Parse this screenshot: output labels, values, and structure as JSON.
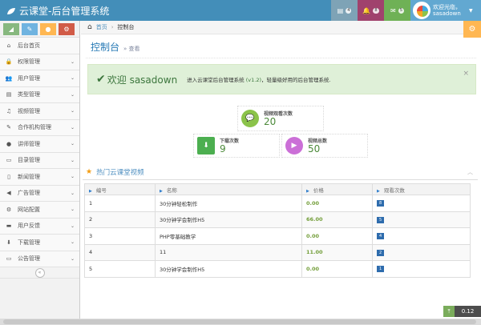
{
  "app": {
    "title": "云课堂-后台管理系统",
    "user_greeting": "欢迎光临，",
    "username": "sasadown"
  },
  "topbar": {
    "tasks_count": "4",
    "notifications_count": "8",
    "messages_count": "5"
  },
  "colors": {
    "navbar": "#438eb9",
    "user": "#62a8d1",
    "tb_tasks": "#7ea3b6",
    "tb_notify": "#a0426d",
    "tb_messages": "#6fb156",
    "settings": "#ffb752"
  },
  "shortcuts": [
    {
      "icon": "signal-icon",
      "color": "#87b87f"
    },
    {
      "icon": "pencil-icon",
      "color": "#6fb3e0"
    },
    {
      "icon": "group-icon",
      "color": "#ffb752"
    },
    {
      "icon": "cogs-icon",
      "color": "#d15b47"
    }
  ],
  "sidebar": {
    "items": [
      {
        "label": "后台首页",
        "icon": "home-icon",
        "glyph": "⌂",
        "arrow": false
      },
      {
        "label": "权限管理",
        "icon": "lock-icon",
        "glyph": "🔒",
        "arrow": true
      },
      {
        "label": "用户管理",
        "icon": "users-icon",
        "glyph": "👥",
        "arrow": true
      },
      {
        "label": "类型管理",
        "icon": "file-icon",
        "glyph": "▤",
        "arrow": true
      },
      {
        "label": "视频管理",
        "icon": "music-icon",
        "glyph": "♫",
        "arrow": true
      },
      {
        "label": "合作机构管理",
        "icon": "edit-icon",
        "glyph": "✎",
        "arrow": true
      },
      {
        "label": "讲师管理",
        "icon": "user-icon",
        "glyph": "●",
        "arrow": true
      },
      {
        "label": "目录管理",
        "icon": "list-icon",
        "glyph": "▭",
        "arrow": true
      },
      {
        "label": "新闻管理",
        "icon": "document-icon",
        "glyph": "▯",
        "arrow": true
      },
      {
        "label": "广告管理",
        "icon": "bullhorn-icon",
        "glyph": "◀",
        "arrow": true
      },
      {
        "label": "网站配置",
        "icon": "cogs-icon",
        "glyph": "⚙",
        "arrow": true
      },
      {
        "label": "用户反馈",
        "icon": "inbox-icon",
        "glyph": "▬",
        "arrow": true
      },
      {
        "label": "下载管理",
        "icon": "download-icon",
        "glyph": "⬇",
        "arrow": true
      },
      {
        "label": "公告管理",
        "icon": "credit-card-icon",
        "glyph": "▭",
        "arrow": true
      }
    ]
  },
  "breadcrumb": {
    "home": "首页",
    "current": "控制台"
  },
  "page": {
    "title": "控制台",
    "subtitle": "» 查看"
  },
  "alert": {
    "welcome": "欢迎",
    "username": "sasadown",
    "msg_pre": "进入云课堂后台管理系统 ",
    "version": "(v1.2)",
    "msg_post": "，轻量级好用的后台管理系统."
  },
  "stats": [
    {
      "label": "视频观看次数",
      "value": "20",
      "icon": "comments-icon",
      "color": "#8bc34a"
    },
    {
      "label": "下载次数",
      "value": "9",
      "icon": "download-icon",
      "color": "#6fb3e0"
    },
    {
      "label": "视频总数",
      "value": "50",
      "icon": "video-icon",
      "color": "#cb6fd7"
    }
  ],
  "widget": {
    "title": "热门云课堂视频"
  },
  "table": {
    "headers": [
      "编号",
      "名称",
      "价格",
      "观看次数"
    ],
    "rows": [
      [
        "1",
        "30分钟轻松制作",
        "0.00",
        "8"
      ],
      [
        "2",
        "30分钟学会制作H5",
        "66.00",
        "5"
      ],
      [
        "3",
        "PHP零基础教学",
        "0.00",
        "4"
      ],
      [
        "4",
        "11",
        "11.00",
        "2"
      ],
      [
        "5",
        "30分钟学会制作H5",
        "0.00",
        "1"
      ]
    ]
  },
  "footer": {
    "zoom": "0.12"
  }
}
